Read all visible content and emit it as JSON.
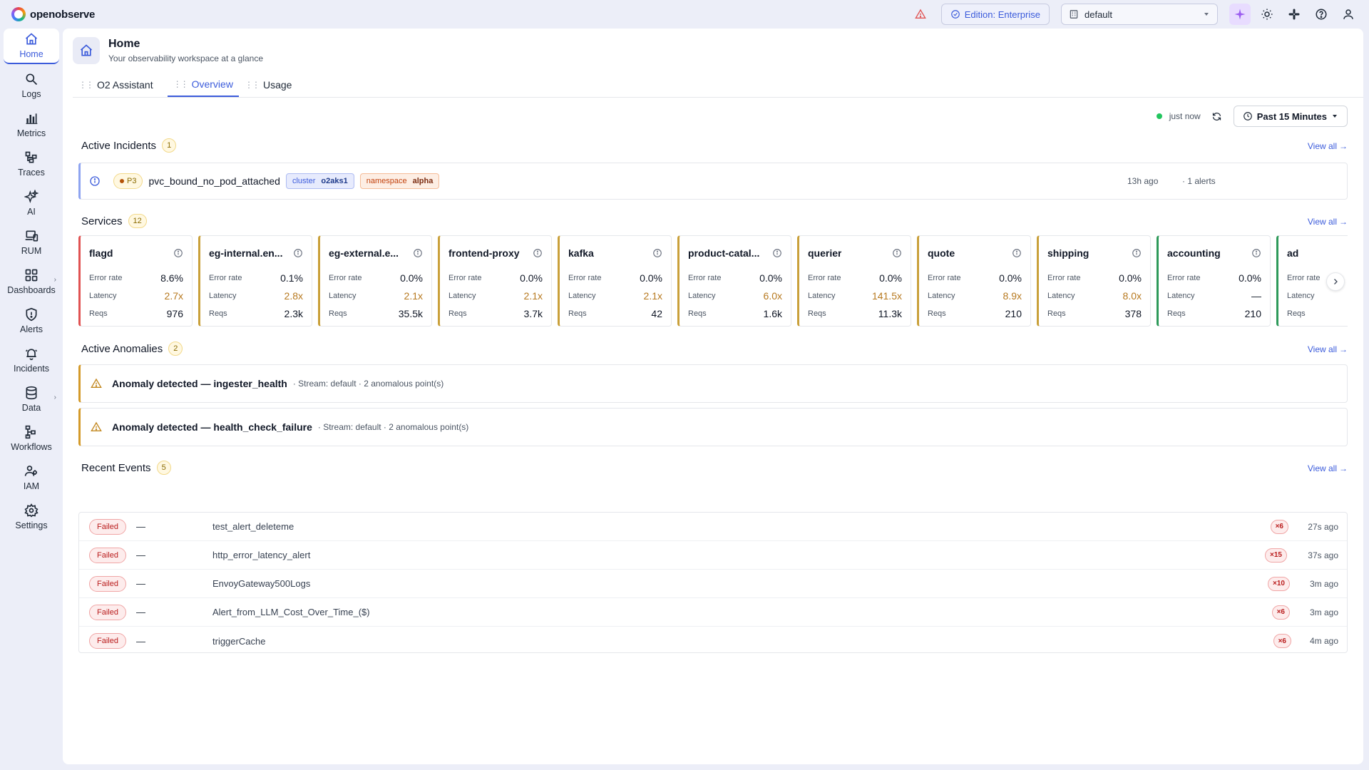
{
  "app": {
    "name": "openobserve"
  },
  "topbar": {
    "edition_label": "Edition: Enterprise",
    "org_value": "default"
  },
  "sidebar": {
    "items": [
      {
        "label": "Home",
        "icon": "home-icon"
      },
      {
        "label": "Logs",
        "icon": "search-icon"
      },
      {
        "label": "Metrics",
        "icon": "bar-chart-icon"
      },
      {
        "label": "Traces",
        "icon": "traces-icon"
      },
      {
        "label": "AI",
        "icon": "sparkle-icon"
      },
      {
        "label": "RUM",
        "icon": "devices-icon"
      },
      {
        "label": "Dashboards",
        "icon": "dashboard-icon"
      },
      {
        "label": "Alerts",
        "icon": "shield-alert-icon"
      },
      {
        "label": "Incidents",
        "icon": "bell-icon"
      },
      {
        "label": "Data",
        "icon": "database-icon"
      },
      {
        "label": "Workflows",
        "icon": "workflow-icon"
      },
      {
        "label": "IAM",
        "icon": "users-icon"
      },
      {
        "label": "Settings",
        "icon": "gear-icon"
      }
    ]
  },
  "page": {
    "title": "Home",
    "subtitle": "Your observability workspace at a glance",
    "tabs": [
      {
        "label": "O2 Assistant"
      },
      {
        "label": "Overview"
      },
      {
        "label": "Usage"
      }
    ]
  },
  "toolbar": {
    "status": "just now",
    "time_range": "Past 15 Minutes"
  },
  "incidents": {
    "title": "Active Incidents",
    "count": "1",
    "view_all": "View all",
    "items": [
      {
        "severity": "P3",
        "name": "pvc_bound_no_pod_attached",
        "tag1_key": "cluster",
        "tag1_val": "o2aks1",
        "tag2_key": "namespace",
        "tag2_val": "alpha",
        "ago": "13h ago",
        "alerts": "· 1 alerts"
      }
    ]
  },
  "services": {
    "title": "Services",
    "count": "12",
    "view_all": "View all",
    "labels": {
      "error": "Error rate",
      "latency": "Latency",
      "reqs": "Reqs"
    },
    "items": [
      {
        "name": "flagd",
        "error": "8.6%",
        "latency": "2.7x",
        "reqs": "976"
      },
      {
        "name": "eg-internal.en...",
        "error": "0.1%",
        "latency": "2.8x",
        "reqs": "2.3k"
      },
      {
        "name": "eg-external.e...",
        "error": "0.0%",
        "latency": "2.1x",
        "reqs": "35.5k"
      },
      {
        "name": "frontend-proxy",
        "error": "0.0%",
        "latency": "2.1x",
        "reqs": "3.7k"
      },
      {
        "name": "kafka",
        "error": "0.0%",
        "latency": "2.1x",
        "reqs": "42"
      },
      {
        "name": "product-catal...",
        "error": "0.0%",
        "latency": "6.0x",
        "reqs": "1.6k"
      },
      {
        "name": "querier",
        "error": "0.0%",
        "latency": "141.5x",
        "reqs": "11.3k"
      },
      {
        "name": "quote",
        "error": "0.0%",
        "latency": "8.9x",
        "reqs": "210"
      },
      {
        "name": "shipping",
        "error": "0.0%",
        "latency": "8.0x",
        "reqs": "378"
      },
      {
        "name": "accounting",
        "error": "0.0%",
        "latency": "—",
        "reqs": "210"
      },
      {
        "name": "ad",
        "error": "",
        "latency": "",
        "reqs": ""
      }
    ]
  },
  "anomalies": {
    "title": "Active Anomalies",
    "count": "2",
    "view_all": "View all",
    "items": [
      {
        "title": "Anomaly detected — ingester_health",
        "meta": "· Stream: default · 2 anomalous point(s)"
      },
      {
        "title": "Anomaly detected — health_check_failure",
        "meta": "· Stream: default · 2 anomalous point(s)"
      }
    ]
  },
  "events": {
    "title": "Recent Events",
    "count": "5",
    "view_all": "View all",
    "items": [
      {
        "status": "Failed",
        "dash": "—",
        "name": "test_alert_deleteme",
        "count": "×6",
        "ago": "27s ago"
      },
      {
        "status": "Failed",
        "dash": "—",
        "name": "http_error_latency_alert",
        "count": "×15",
        "ago": "37s ago"
      },
      {
        "status": "Failed",
        "dash": "—",
        "name": "EnvoyGateway500Logs",
        "count": "×10",
        "ago": "3m ago"
      },
      {
        "status": "Failed",
        "dash": "—",
        "name": "Alert_from_LLM_Cost_Over_Time_($)",
        "count": "×6",
        "ago": "3m ago"
      },
      {
        "status": "Failed",
        "dash": "—",
        "name": "triggerCache",
        "count": "×6",
        "ago": "4m ago"
      }
    ]
  },
  "colors": {
    "accent": "#3b5bdb",
    "warning": "#b7791f",
    "error": "#b91c1c",
    "ok": "#22c55e"
  }
}
